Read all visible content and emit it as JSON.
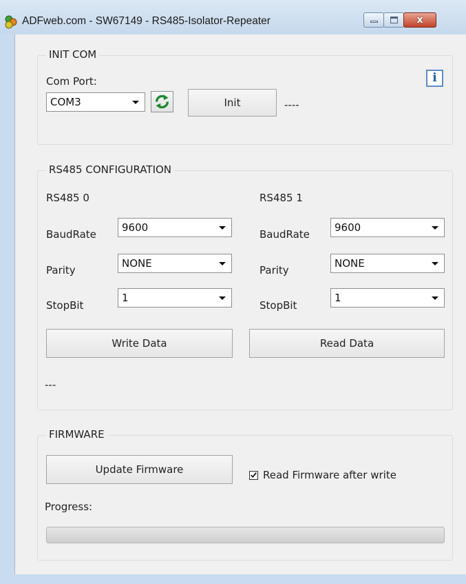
{
  "window": {
    "title": "ADFweb.com - SW67149 - RS485-Isolator-Repeater",
    "close_glyph": "x"
  },
  "init_com": {
    "legend": "INIT COM",
    "com_port_label": "Com Port:",
    "com_port_value": "COM3",
    "init_button": "Init",
    "status": "----",
    "info_glyph": "i"
  },
  "rs485": {
    "legend": "RS485 CONFIGURATION",
    "port0": {
      "title": "RS485 0",
      "baudrate_label": "BaudRate",
      "baudrate": "9600",
      "parity_label": "Parity",
      "parity": "NONE",
      "stopbit_label": "StopBit",
      "stopbit": "1"
    },
    "port1": {
      "title": "RS485 1",
      "baudrate_label": "BaudRate",
      "baudrate": "9600",
      "parity_label": "Parity",
      "parity": "NONE",
      "stopbit_label": "StopBit",
      "stopbit": "1"
    },
    "write_button": "Write Data",
    "read_button": "Read Data",
    "status": "---"
  },
  "firmware": {
    "legend": "FIRMWARE",
    "update_button": "Update Firmware",
    "read_after_write_label": "Read Firmware after write",
    "read_after_write_checked": true,
    "progress_label": "Progress:",
    "progress_value": 0
  },
  "icons": [
    "app-icon",
    "refresh-icon",
    "info-icon",
    "checkbox-check-icon",
    "dropdown-arrow-icon"
  ]
}
